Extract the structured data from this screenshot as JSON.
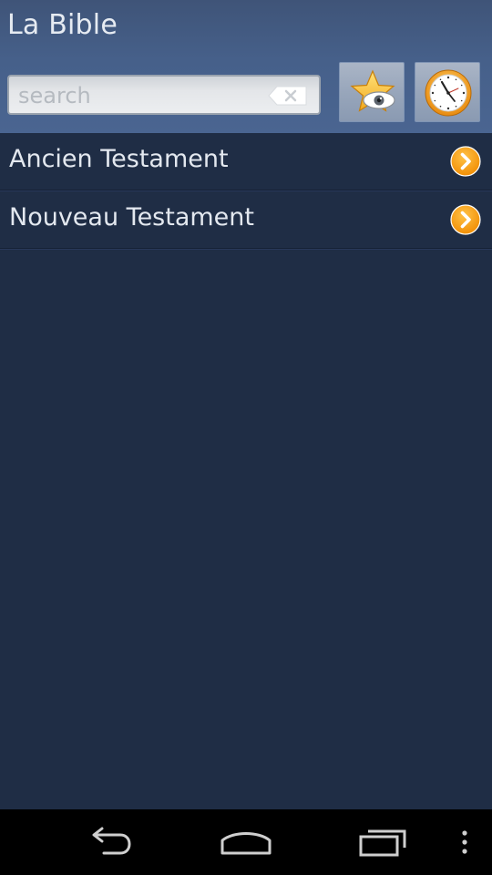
{
  "header": {
    "title": "La Bible"
  },
  "search": {
    "placeholder": "search",
    "value": ""
  },
  "toolbar": {
    "favorites_icon": "star-eye-icon",
    "history_icon": "clock-icon"
  },
  "list": {
    "items": [
      {
        "label": "Ancien Testament",
        "icon": "chevron-right-icon"
      },
      {
        "label": "Nouveau Testament",
        "icon": "chevron-right-icon"
      }
    ]
  },
  "navbar": {
    "icons": [
      "back-icon",
      "home-icon",
      "recent-apps-icon",
      "overflow-menu-icon"
    ]
  },
  "colors": {
    "background": "#1f2d45",
    "header": "#46608a",
    "accent": "#f39c12",
    "text": "#e3e8ef"
  }
}
